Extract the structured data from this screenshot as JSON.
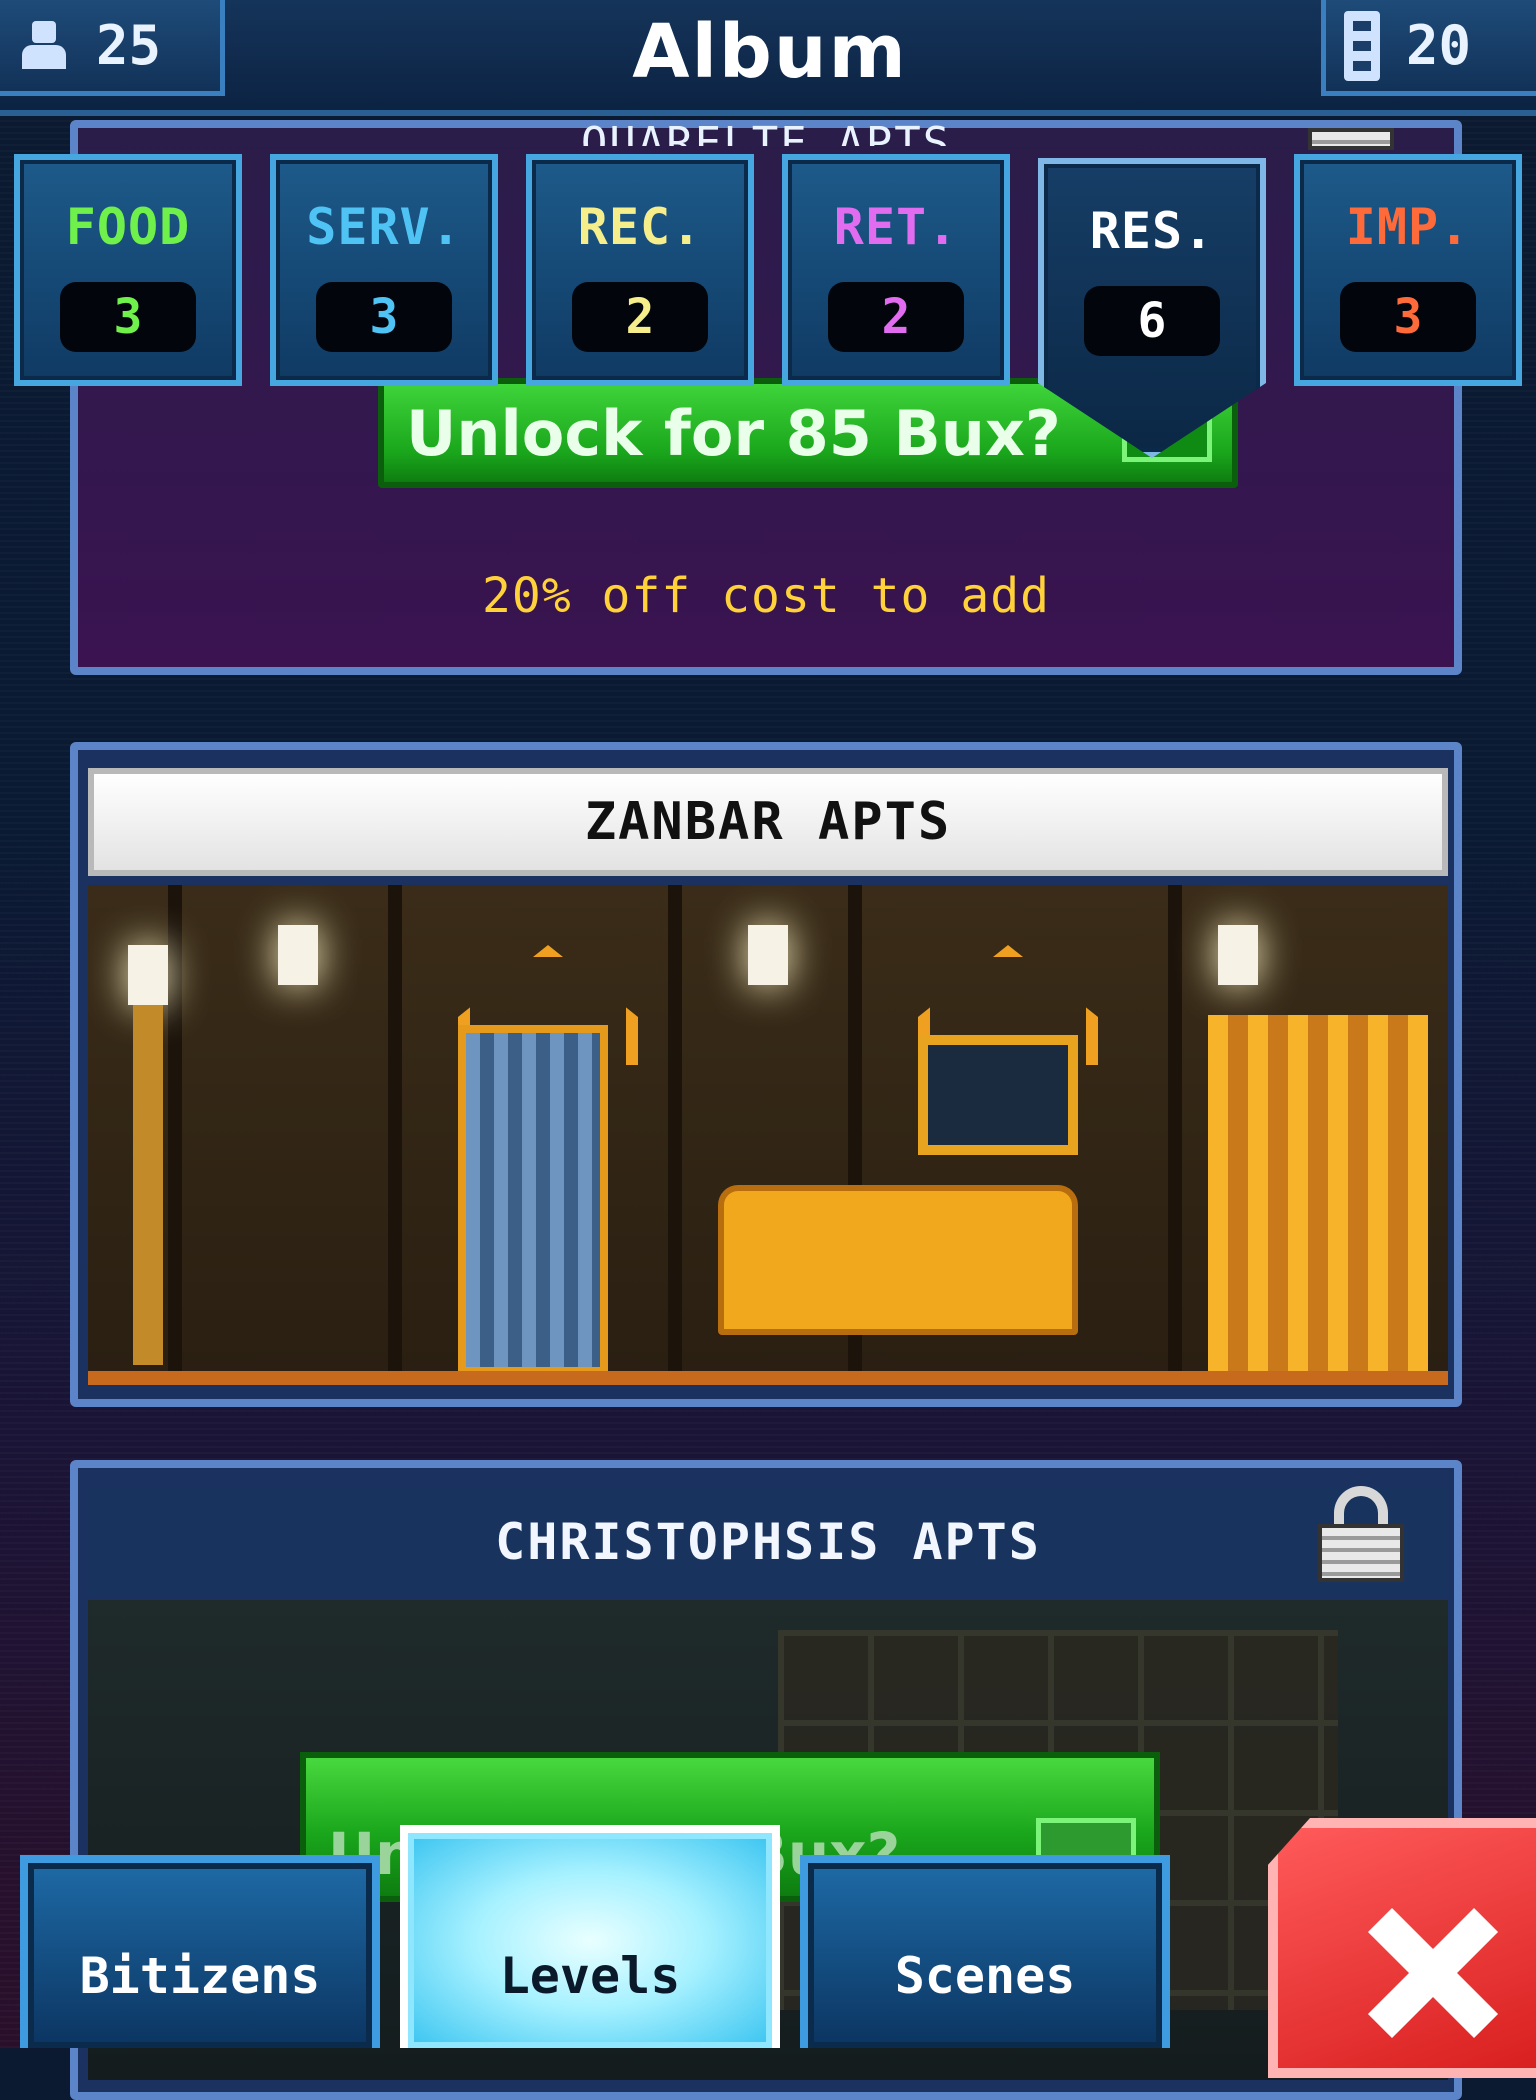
{
  "header": {
    "title": "Album",
    "bitizens_count": "25",
    "floors_count": "20"
  },
  "categories": [
    {
      "label": "FOOD",
      "count": "3",
      "color": "#6ff04a",
      "selected": false
    },
    {
      "label": "SERV.",
      "count": "3",
      "color": "#4fc4f4",
      "selected": false
    },
    {
      "label": "REC.",
      "count": "2",
      "color": "#f6ee8a",
      "selected": false
    },
    {
      "label": "RET.",
      "count": "2",
      "color": "#e26cf0",
      "selected": false
    },
    {
      "label": "RES.",
      "count": "6",
      "color": "#ffffff",
      "selected": true
    },
    {
      "label": "IMP.",
      "count": "3",
      "color": "#ff6a3a",
      "selected": false
    }
  ],
  "levels": [
    {
      "name": "QUARELTE APTS",
      "locked": true,
      "unlock_label": "Unlock for 85 Bux?",
      "discount_text": "20% off cost to add"
    },
    {
      "name": "ZANBAR APTS",
      "locked": false
    },
    {
      "name": "CHRISTOPHSIS APTS",
      "locked": true,
      "unlock_label": "Unlock for 1 Bux?"
    }
  ],
  "bottom_nav": {
    "tabs": [
      {
        "label": "Bitizens",
        "active": false
      },
      {
        "label": "Levels",
        "active": true
      },
      {
        "label": "Scenes",
        "active": false
      }
    ]
  },
  "colors": {
    "accent_blue": "#46a6e0",
    "unlock_green": "#1aa61c",
    "discount_yellow": "#ffd23a",
    "close_red": "#d81e1e"
  }
}
